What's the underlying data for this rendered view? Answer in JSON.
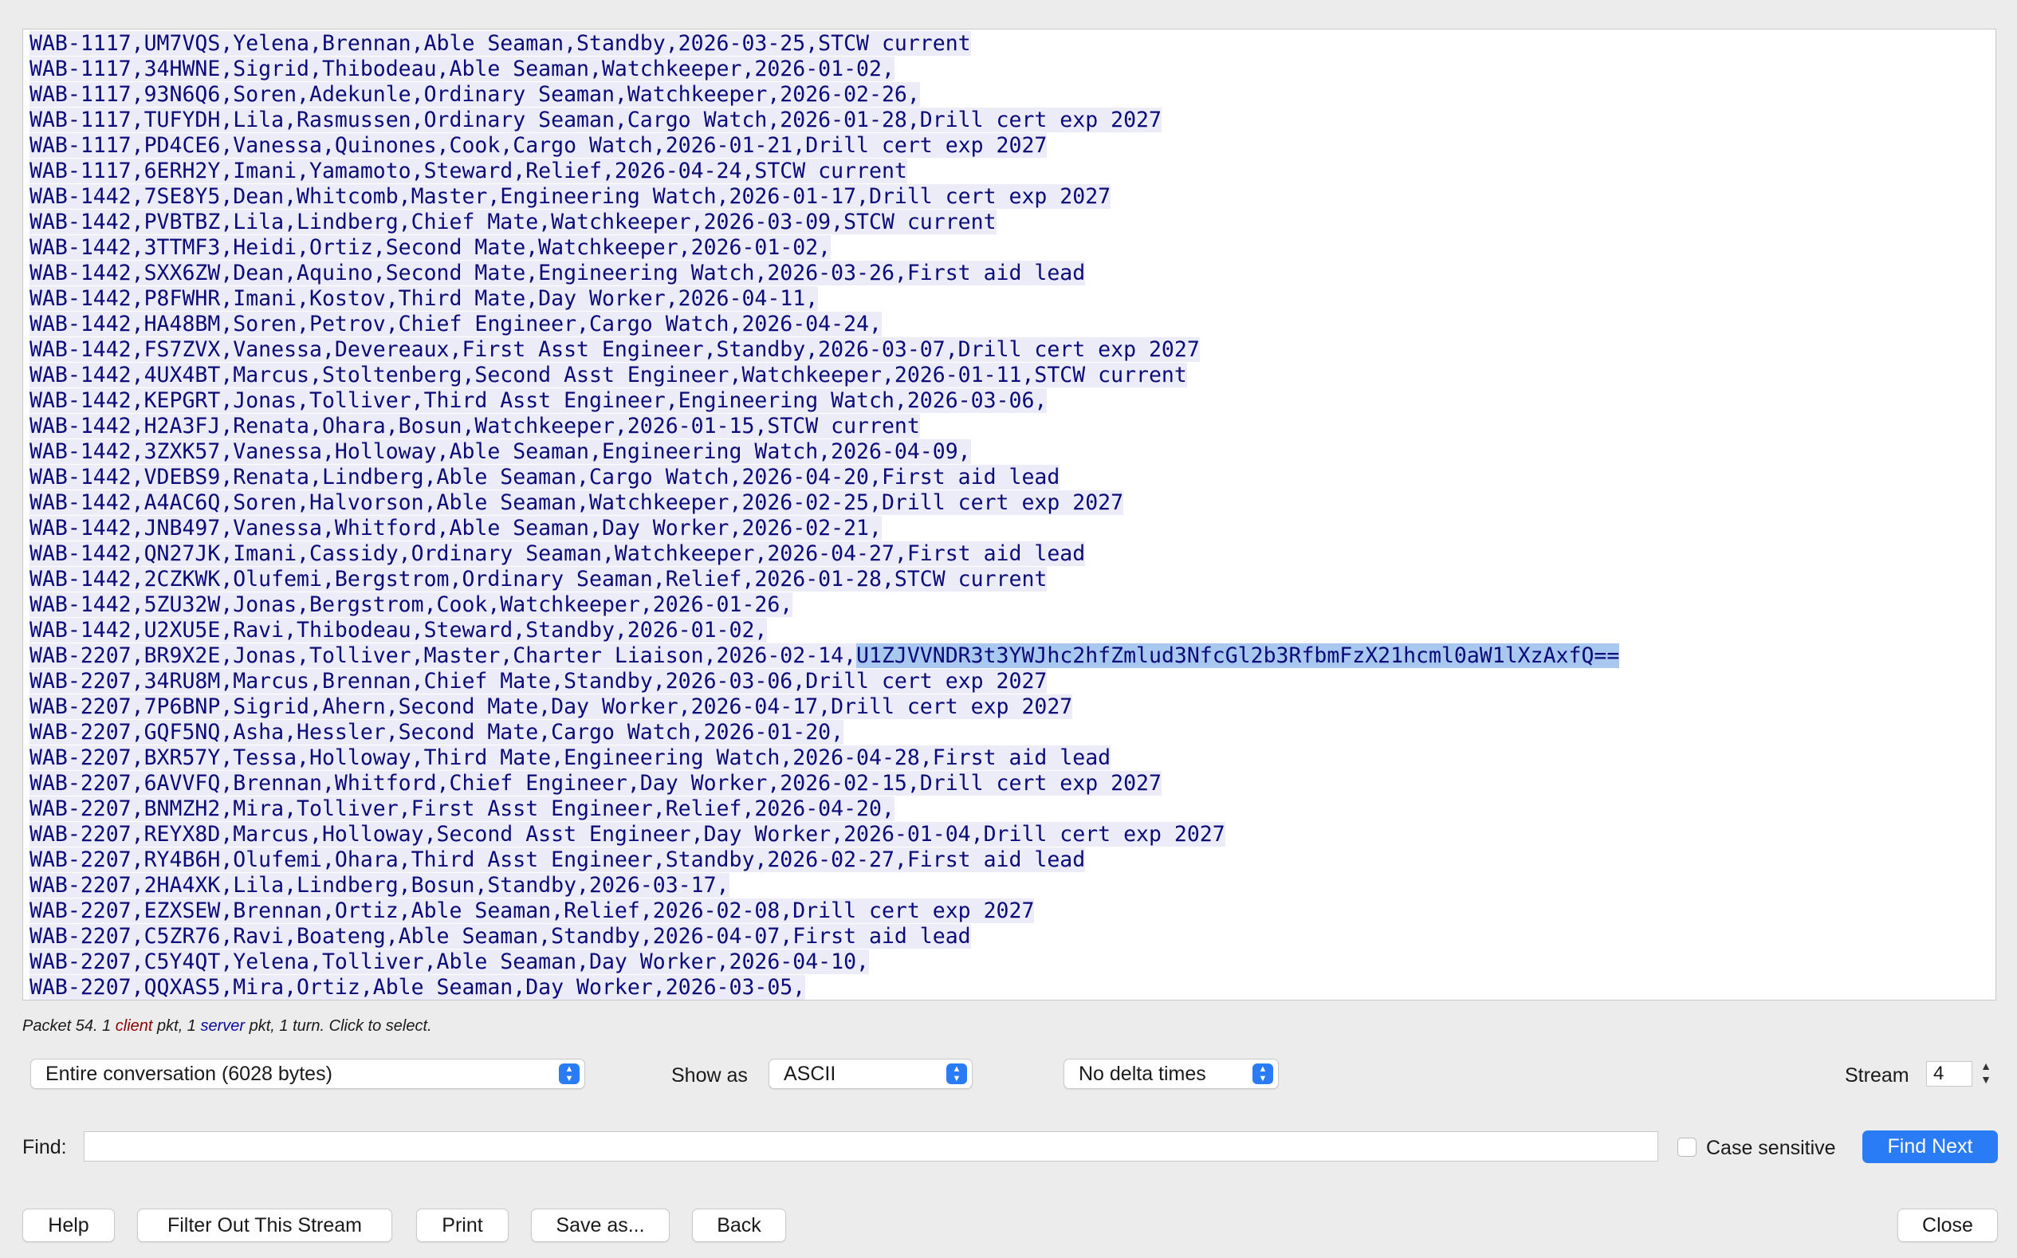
{
  "stream_lines": [
    "WAB-1117,UM7VQS,Yelena,Brennan,Able Seaman,Standby,2026-03-25,STCW current",
    "WAB-1117,34HWNE,Sigrid,Thibodeau,Able Seaman,Watchkeeper,2026-01-02,",
    "WAB-1117,93N6Q6,Soren,Adekunle,Ordinary Seaman,Watchkeeper,2026-02-26,",
    "WAB-1117,TUFYDH,Lila,Rasmussen,Ordinary Seaman,Cargo Watch,2026-01-28,Drill cert exp 2027",
    "WAB-1117,PD4CE6,Vanessa,Quinones,Cook,Cargo Watch,2026-01-21,Drill cert exp 2027",
    "WAB-1117,6ERH2Y,Imani,Yamamoto,Steward,Relief,2026-04-24,STCW current",
    "WAB-1442,7SE8Y5,Dean,Whitcomb,Master,Engineering Watch,2026-01-17,Drill cert exp 2027",
    "WAB-1442,PVBTBZ,Lila,Lindberg,Chief Mate,Watchkeeper,2026-03-09,STCW current",
    "WAB-1442,3TTMF3,Heidi,Ortiz,Second Mate,Watchkeeper,2026-01-02,",
    "WAB-1442,SXX6ZW,Dean,Aquino,Second Mate,Engineering Watch,2026-03-26,First aid lead",
    "WAB-1442,P8FWHR,Imani,Kostov,Third Mate,Day Worker,2026-04-11,",
    "WAB-1442,HA48BM,Soren,Petrov,Chief Engineer,Cargo Watch,2026-04-24,",
    "WAB-1442,FS7ZVX,Vanessa,Devereaux,First Asst Engineer,Standby,2026-03-07,Drill cert exp 2027",
    "WAB-1442,4UX4BT,Marcus,Stoltenberg,Second Asst Engineer,Watchkeeper,2026-01-11,STCW current",
    "WAB-1442,KEPGRT,Jonas,Tolliver,Third Asst Engineer,Engineering Watch,2026-03-06,",
    "WAB-1442,H2A3FJ,Renata,Ohara,Bosun,Watchkeeper,2026-01-15,STCW current",
    "WAB-1442,3ZXK57,Vanessa,Holloway,Able Seaman,Engineering Watch,2026-04-09,",
    "WAB-1442,VDEBS9,Renata,Lindberg,Able Seaman,Cargo Watch,2026-04-20,First aid lead",
    "WAB-1442,A4AC6Q,Soren,Halvorson,Able Seaman,Watchkeeper,2026-02-25,Drill cert exp 2027",
    "WAB-1442,JNB497,Vanessa,Whitford,Able Seaman,Day Worker,2026-02-21,",
    "WAB-1442,QN27JK,Imani,Cassidy,Ordinary Seaman,Watchkeeper,2026-04-27,First aid lead",
    "WAB-1442,2CZKWK,Olufemi,Bergstrom,Ordinary Seaman,Relief,2026-01-28,STCW current",
    "WAB-1442,5ZU32W,Jonas,Bergstrom,Cook,Watchkeeper,2026-01-26,",
    "WAB-1442,U2XU5E,Ravi,Thibodeau,Steward,Standby,2026-01-02,",
    "WAB-2207,BR9X2E,Jonas,Tolliver,Master,Charter Liaison,2026-02-14,U1ZJVVNDR3t3YWJhc2hfZmlud3NfcGl2b3RfbmFzX21hcml0aW1lXzAxfQ==",
    "WAB-2207,34RU8M,Marcus,Brennan,Chief Mate,Standby,2026-03-06,Drill cert exp 2027",
    "WAB-2207,7P6BNP,Sigrid,Ahern,Second Mate,Day Worker,2026-04-17,Drill cert exp 2027",
    "WAB-2207,GQF5NQ,Asha,Hessler,Second Mate,Cargo Watch,2026-01-20,",
    "WAB-2207,BXR57Y,Tessa,Holloway,Third Mate,Engineering Watch,2026-04-28,First aid lead",
    "WAB-2207,6AVVFQ,Brennan,Whitford,Chief Engineer,Day Worker,2026-02-15,Drill cert exp 2027",
    "WAB-2207,BNMZH2,Mira,Tolliver,First Asst Engineer,Relief,2026-04-20,",
    "WAB-2207,REYX8D,Marcus,Holloway,Second Asst Engineer,Day Worker,2026-01-04,Drill cert exp 2027",
    "WAB-2207,RY4B6H,Olufemi,Ohara,Third Asst Engineer,Standby,2026-02-27,First aid lead",
    "WAB-2207,2HA4XK,Lila,Lindberg,Bosun,Standby,2026-03-17,",
    "WAB-2207,EZXSEW,Brennan,Ortiz,Able Seaman,Relief,2026-02-08,Drill cert exp 2027",
    "WAB-2207,C5ZR76,Ravi,Boateng,Able Seaman,Standby,2026-04-07,First aid lead",
    "WAB-2207,C5Y4QT,Yelena,Tolliver,Able Seaman,Day Worker,2026-04-10,",
    "WAB-2207,QQXAS5,Mira,Ortiz,Able Seaman,Day Worker,2026-03-05,"
  ],
  "selection": {
    "line_index": 24,
    "text": "U1ZJVVNDR3t3YWJhc2hfZmlud3NfcGl2b3RfbmFzX21hcml0aW1lXzAxfQ=="
  },
  "status": {
    "prefix": "Packet 54. 1 ",
    "client": "client",
    "middle": " pkt, 1 ",
    "server": "server",
    "suffix": " pkt, 1 turn. Click to select."
  },
  "controls": {
    "conversation": "Entire conversation (6028 bytes)",
    "show_as_label": "Show as",
    "show_as": "ASCII",
    "delta": "No delta times",
    "stream_label": "Stream",
    "stream_value": "4",
    "find_label": "Find:",
    "find_value": "",
    "case_sensitive": "Case sensitive",
    "find_next": "Find Next"
  },
  "buttons": {
    "help": "Help",
    "filter_out": "Filter Out This Stream",
    "print": "Print",
    "save_as": "Save as...",
    "back": "Back",
    "close": "Close"
  },
  "colors": {
    "client_text": "#0a0a78",
    "client_bg": "#ececf9",
    "selection_bg": "#a9c8ef",
    "accent": "#2a7cf6"
  }
}
